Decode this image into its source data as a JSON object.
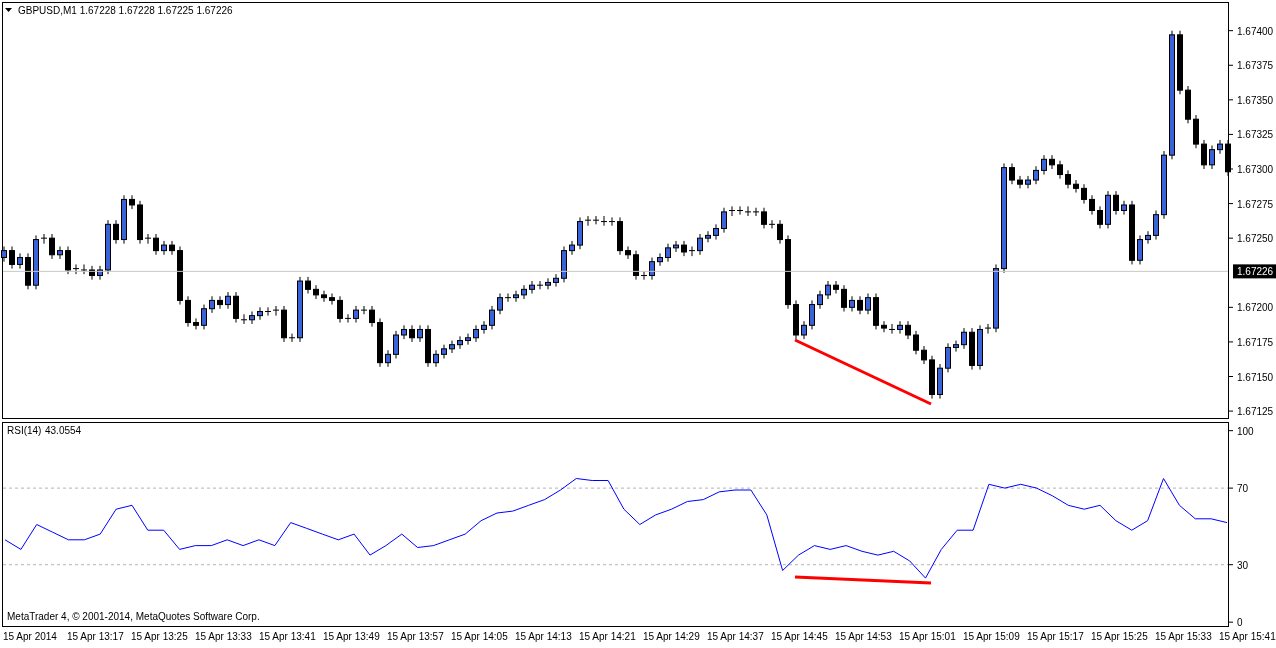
{
  "main_chart": {
    "symbol_line": "GBPUSD,M1  1.67228 1.67228 1.67225 1.67226",
    "current_price": "1.67226",
    "chart_data": {
      "type": "candlestick",
      "ylim": [
        1.6712,
        1.6742
      ],
      "yticks": [
        {
          "value": 1.674,
          "label": "1.67400"
        },
        {
          "value": 1.67375,
          "label": "1.67375"
        },
        {
          "value": 1.6735,
          "label": "1.67350"
        },
        {
          "value": 1.67325,
          "label": "1.67325"
        },
        {
          "value": 1.673,
          "label": "1.67300"
        },
        {
          "value": 1.67275,
          "label": "1.67275"
        },
        {
          "value": 1.6725,
          "label": "1.67250"
        },
        {
          "value": 1.672,
          "label": "1.67200"
        },
        {
          "value": 1.67175,
          "label": "1.67175"
        },
        {
          "value": 1.6715,
          "label": "1.67150"
        },
        {
          "value": 1.67125,
          "label": "1.67125"
        }
      ],
      "ohlc": [
        [
          1.67236,
          1.67244,
          1.67233,
          1.67241
        ],
        [
          1.67241,
          1.67244,
          1.67228,
          1.67231
        ],
        [
          1.67231,
          1.67239,
          1.67228,
          1.67236
        ],
        [
          1.67236,
          1.67239,
          1.67213,
          1.67216
        ],
        [
          1.67216,
          1.67252,
          1.67213,
          1.67249
        ],
        [
          1.67249,
          1.67253,
          1.67246,
          1.6725
        ],
        [
          1.6725,
          1.67253,
          1.67235,
          1.67238
        ],
        [
          1.67238,
          1.67244,
          1.67235,
          1.67241
        ],
        [
          1.67241,
          1.67244,
          1.67224,
          1.67227
        ],
        [
          1.67227,
          1.67231,
          1.67224,
          1.67228
        ],
        [
          1.67228,
          1.67231,
          1.67224,
          1.67227
        ],
        [
          1.67227,
          1.6723,
          1.6722,
          1.67223
        ],
        [
          1.67223,
          1.6723,
          1.6722,
          1.67227
        ],
        [
          1.67227,
          1.67263,
          1.67224,
          1.6726
        ],
        [
          1.6726,
          1.67263,
          1.67246,
          1.67249
        ],
        [
          1.67249,
          1.67281,
          1.67246,
          1.67278
        ],
        [
          1.67278,
          1.67281,
          1.67271,
          1.67274
        ],
        [
          1.67274,
          1.67277,
          1.67246,
          1.67249
        ],
        [
          1.67249,
          1.67253,
          1.67246,
          1.6725
        ],
        [
          1.6725,
          1.67253,
          1.67238,
          1.67241
        ],
        [
          1.67241,
          1.67248,
          1.67238,
          1.67245
        ],
        [
          1.67245,
          1.67248,
          1.67238,
          1.67241
        ],
        [
          1.67241,
          1.67244,
          1.67202,
          1.67205
        ],
        [
          1.67205,
          1.67208,
          1.67186,
          1.67189
        ],
        [
          1.67189,
          1.67192,
          1.67184,
          1.67187
        ],
        [
          1.67187,
          1.67202,
          1.67184,
          1.67199
        ],
        [
          1.67199,
          1.67208,
          1.67196,
          1.67205
        ],
        [
          1.67205,
          1.67208,
          1.67199,
          1.67202
        ],
        [
          1.67202,
          1.67211,
          1.67199,
          1.67208
        ],
        [
          1.67208,
          1.67211,
          1.67189,
          1.67192
        ],
        [
          1.67192,
          1.67195,
          1.67188,
          1.67191
        ],
        [
          1.67191,
          1.67197,
          1.67188,
          1.67194
        ],
        [
          1.67194,
          1.672,
          1.67191,
          1.67197
        ],
        [
          1.67197,
          1.672,
          1.67194,
          1.67197
        ],
        [
          1.67197,
          1.67201,
          1.67194,
          1.67198
        ],
        [
          1.67198,
          1.67201,
          1.67175,
          1.67178
        ],
        [
          1.67178,
          1.67181,
          1.67175,
          1.67178
        ],
        [
          1.67178,
          1.67222,
          1.67175,
          1.67219
        ],
        [
          1.67219,
          1.67222,
          1.6721,
          1.67213
        ],
        [
          1.67213,
          1.67216,
          1.67206,
          1.67209
        ],
        [
          1.67209,
          1.67212,
          1.67204,
          1.67207
        ],
        [
          1.67207,
          1.6721,
          1.67202,
          1.67205
        ],
        [
          1.67205,
          1.67208,
          1.67189,
          1.67192
        ],
        [
          1.67192,
          1.67195,
          1.67189,
          1.67192
        ],
        [
          1.67192,
          1.67201,
          1.67189,
          1.67198
        ],
        [
          1.67198,
          1.67201,
          1.67195,
          1.67198
        ],
        [
          1.67198,
          1.67201,
          1.67186,
          1.67189
        ],
        [
          1.67189,
          1.67192,
          1.67157,
          1.6716
        ],
        [
          1.6716,
          1.67169,
          1.67157,
          1.67166
        ],
        [
          1.67166,
          1.67183,
          1.67163,
          1.6718
        ],
        [
          1.6718,
          1.67187,
          1.67177,
          1.67184
        ],
        [
          1.67184,
          1.67187,
          1.67175,
          1.67178
        ],
        [
          1.67178,
          1.67187,
          1.67175,
          1.67184
        ],
        [
          1.67184,
          1.67187,
          1.67157,
          1.6716
        ],
        [
          1.6716,
          1.67169,
          1.67157,
          1.67166
        ],
        [
          1.67166,
          1.67173,
          1.67163,
          1.6717
        ],
        [
          1.6717,
          1.67176,
          1.67167,
          1.67173
        ],
        [
          1.67173,
          1.67179,
          1.6717,
          1.67176
        ],
        [
          1.67176,
          1.67181,
          1.67173,
          1.67178
        ],
        [
          1.67178,
          1.67187,
          1.67175,
          1.67184
        ],
        [
          1.67184,
          1.6719,
          1.67181,
          1.67187
        ],
        [
          1.67187,
          1.67201,
          1.67184,
          1.67198
        ],
        [
          1.67198,
          1.6721,
          1.67195,
          1.67207
        ],
        [
          1.67207,
          1.6721,
          1.67204,
          1.67207
        ],
        [
          1.67207,
          1.67212,
          1.67204,
          1.67209
        ],
        [
          1.67209,
          1.67216,
          1.67206,
          1.67213
        ],
        [
          1.67213,
          1.67219,
          1.6721,
          1.67216
        ],
        [
          1.67216,
          1.67219,
          1.67213,
          1.67216
        ],
        [
          1.67216,
          1.67221,
          1.67213,
          1.67218
        ],
        [
          1.67218,
          1.67224,
          1.67215,
          1.67221
        ],
        [
          1.67221,
          1.67244,
          1.67218,
          1.67241
        ],
        [
          1.67241,
          1.67248,
          1.67238,
          1.67245
        ],
        [
          1.67245,
          1.67265,
          1.67242,
          1.67262
        ],
        [
          1.67262,
          1.67266,
          1.67259,
          1.67263
        ],
        [
          1.67263,
          1.67266,
          1.6726,
          1.67263
        ],
        [
          1.67263,
          1.67266,
          1.67259,
          1.67262
        ],
        [
          1.67262,
          1.67265,
          1.67259,
          1.67262
        ],
        [
          1.67262,
          1.67265,
          1.67238,
          1.67241
        ],
        [
          1.67241,
          1.67244,
          1.67235,
          1.67238
        ],
        [
          1.67238,
          1.67241,
          1.6722,
          1.67223
        ],
        [
          1.67223,
          1.67226,
          1.6722,
          1.67223
        ],
        [
          1.67223,
          1.67236,
          1.6722,
          1.67233
        ],
        [
          1.67233,
          1.67239,
          1.6723,
          1.67236
        ],
        [
          1.67236,
          1.67246,
          1.67233,
          1.67243
        ],
        [
          1.67243,
          1.67248,
          1.6724,
          1.67245
        ],
        [
          1.67245,
          1.67248,
          1.67237,
          1.6724
        ],
        [
          1.6724,
          1.67244,
          1.67237,
          1.67241
        ],
        [
          1.67241,
          1.67253,
          1.67238,
          1.6725
        ],
        [
          1.6725,
          1.67255,
          1.67247,
          1.67252
        ],
        [
          1.67252,
          1.6726,
          1.67249,
          1.67257
        ],
        [
          1.67257,
          1.67272,
          1.67254,
          1.67269
        ],
        [
          1.67269,
          1.67273,
          1.67266,
          1.6727
        ],
        [
          1.6727,
          1.67273,
          1.67267,
          1.6727
        ],
        [
          1.6727,
          1.67273,
          1.67266,
          1.67269
        ],
        [
          1.67269,
          1.67272,
          1.67266,
          1.67269
        ],
        [
          1.67269,
          1.67272,
          1.67257,
          1.6726
        ],
        [
          1.6726,
          1.67263,
          1.67257,
          1.6726
        ],
        [
          1.6726,
          1.67263,
          1.67246,
          1.67249
        ],
        [
          1.67249,
          1.67252,
          1.67199,
          1.67202
        ],
        [
          1.67202,
          1.67205,
          1.67177,
          1.6718
        ],
        [
          1.6718,
          1.6719,
          1.67177,
          1.67187
        ],
        [
          1.67187,
          1.67205,
          1.67184,
          1.67202
        ],
        [
          1.67202,
          1.67212,
          1.67199,
          1.67209
        ],
        [
          1.67209,
          1.67219,
          1.67206,
          1.67216
        ],
        [
          1.67216,
          1.67219,
          1.6721,
          1.67213
        ],
        [
          1.67213,
          1.67216,
          1.67197,
          1.672
        ],
        [
          1.672,
          1.67208,
          1.67197,
          1.67205
        ],
        [
          1.67205,
          1.67208,
          1.67195,
          1.67198
        ],
        [
          1.67198,
          1.6721,
          1.67195,
          1.67207
        ],
        [
          1.67207,
          1.6721,
          1.67184,
          1.67187
        ],
        [
          1.67187,
          1.6719,
          1.67182,
          1.67185
        ],
        [
          1.67185,
          1.67188,
          1.67181,
          1.67184
        ],
        [
          1.67184,
          1.6719,
          1.67181,
          1.67187
        ],
        [
          1.67187,
          1.6719,
          1.67177,
          1.6718
        ],
        [
          1.6718,
          1.67183,
          1.67166,
          1.67169
        ],
        [
          1.67169,
          1.67172,
          1.67159,
          1.67162
        ],
        [
          1.67162,
          1.67165,
          1.67134,
          1.67137
        ],
        [
          1.67137,
          1.67159,
          1.67134,
          1.67156
        ],
        [
          1.67156,
          1.67174,
          1.67153,
          1.67171
        ],
        [
          1.67171,
          1.67176,
          1.67168,
          1.67173
        ],
        [
          1.67173,
          1.67185,
          1.6717,
          1.67182
        ],
        [
          1.67182,
          1.67185,
          1.67155,
          1.67158
        ],
        [
          1.67158,
          1.67187,
          1.67155,
          1.67184
        ],
        [
          1.67184,
          1.67188,
          1.67181,
          1.67185
        ],
        [
          1.67185,
          1.67231,
          1.67182,
          1.67228
        ],
        [
          1.67228,
          1.67304,
          1.67225,
          1.67301
        ],
        [
          1.67301,
          1.67304,
          1.67289,
          1.67292
        ],
        [
          1.67292,
          1.67295,
          1.67286,
          1.67289
        ],
        [
          1.67289,
          1.67295,
          1.67286,
          1.67292
        ],
        [
          1.67292,
          1.67302,
          1.67289,
          1.67299
        ],
        [
          1.67299,
          1.6731,
          1.67296,
          1.67307
        ],
        [
          1.67307,
          1.6731,
          1.673,
          1.67303
        ],
        [
          1.67303,
          1.67306,
          1.67293,
          1.67296
        ],
        [
          1.67296,
          1.67299,
          1.67286,
          1.67289
        ],
        [
          1.67289,
          1.67292,
          1.67283,
          1.67286
        ],
        [
          1.67286,
          1.67289,
          1.67275,
          1.67278
        ],
        [
          1.67278,
          1.67281,
          1.67267,
          1.6727
        ],
        [
          1.6727,
          1.67273,
          1.67257,
          1.6726
        ],
        [
          1.6726,
          1.67284,
          1.67257,
          1.67281
        ],
        [
          1.67281,
          1.67284,
          1.67267,
          1.6727
        ],
        [
          1.6727,
          1.67277,
          1.67267,
          1.67274
        ],
        [
          1.67274,
          1.67277,
          1.67231,
          1.67234
        ],
        [
          1.67234,
          1.67252,
          1.67231,
          1.67249
        ],
        [
          1.67249,
          1.67255,
          1.67246,
          1.67252
        ],
        [
          1.67252,
          1.6727,
          1.67249,
          1.67267
        ],
        [
          1.67267,
          1.67313,
          1.67264,
          1.6731
        ],
        [
          1.6731,
          1.674,
          1.67307,
          1.67397
        ],
        [
          1.67397,
          1.674,
          1.67354,
          1.67357
        ],
        [
          1.67357,
          1.6736,
          1.67333,
          1.67336
        ],
        [
          1.67336,
          1.67339,
          1.67315,
          1.67318
        ],
        [
          1.67318,
          1.67321,
          1.673,
          1.67303
        ],
        [
          1.67303,
          1.67317,
          1.673,
          1.67314
        ],
        [
          1.67314,
          1.67321,
          1.67311,
          1.67318
        ],
        [
          1.67318,
          1.67321,
          1.67295,
          1.67298
        ]
      ]
    }
  },
  "rsi_panel": {
    "reading": "43.0554",
    "copyright": "MetaTrader 4, © 2001-2014, MetaQuotes Software Corp.",
    "chart_data": {
      "type": "line",
      "ylim": [
        -2,
        104
      ],
      "yticks": [
        0,
        30,
        70,
        100
      ],
      "series": [
        {
          "name": "RSI(14)",
          "color": "#0000ff",
          "values": [
            43,
            38,
            51,
            47,
            43,
            43,
            46,
            59,
            61,
            48,
            48,
            38,
            40,
            40,
            43,
            40,
            43,
            40,
            52,
            49,
            46,
            43,
            46,
            35,
            40,
            46,
            39,
            40,
            43,
            46,
            53,
            57,
            58,
            61,
            64,
            69,
            75,
            74,
            74,
            59,
            51,
            56,
            59,
            63,
            64,
            68,
            69,
            69,
            56,
            27,
            35,
            40,
            38,
            40,
            37,
            35,
            37,
            32,
            23,
            38,
            48,
            48,
            72,
            70,
            72,
            70,
            66,
            61,
            59,
            61,
            53,
            48,
            53,
            75,
            61,
            54,
            54,
            52
          ]
        }
      ]
    }
  },
  "time_axis": [
    "15 Apr 2014",
    "15 Apr 13:17",
    "15 Apr 13:25",
    "15 Apr 13:33",
    "15 Apr 13:41",
    "15 Apr 13:49",
    "15 Apr 13:57",
    "15 Apr 14:05",
    "15 Apr 14:13",
    "15 Apr 14:21",
    "15 Apr 14:29",
    "15 Apr 14:37",
    "15 Apr 14:45",
    "15 Apr 14:53",
    "15 Apr 15:01",
    "15 Apr 15:09",
    "15 Apr 15:17",
    "15 Apr 15:25",
    "15 Apr 15:33",
    "15 Apr 15:41"
  ]
}
